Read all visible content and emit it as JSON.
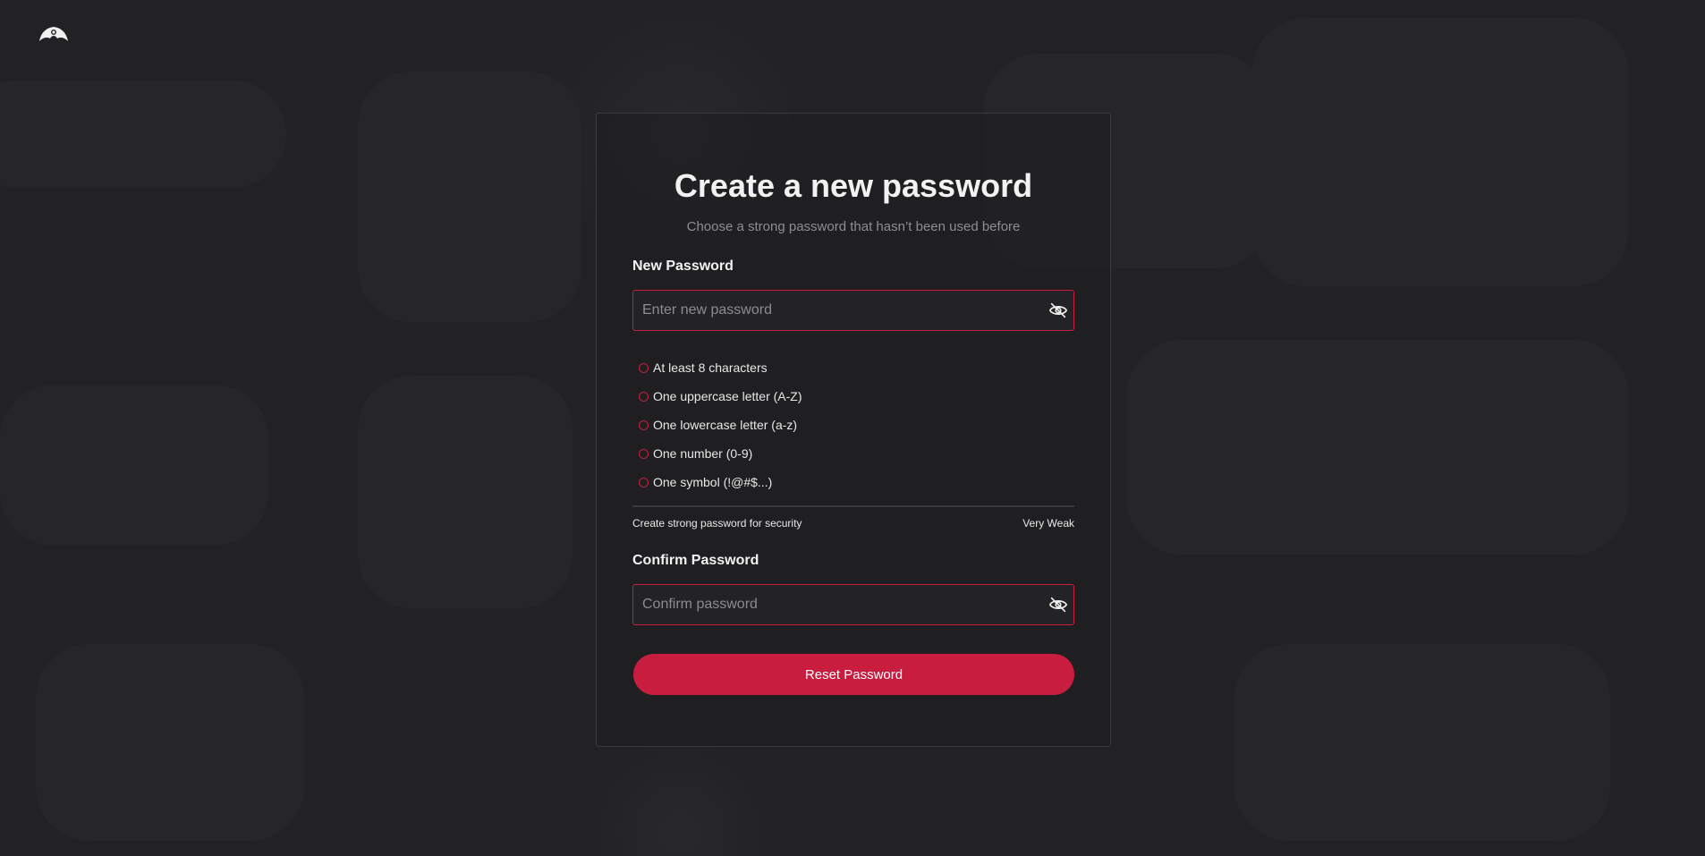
{
  "logo": {
    "icon": "bat-logo-icon"
  },
  "card": {
    "title": "Create a new password",
    "subtitle": "Choose a strong password that hasn’t been used before"
  },
  "new_password": {
    "label": "New Password",
    "placeholder": "Enter new password",
    "value": "",
    "toggle_icon": "eye-slash-icon"
  },
  "requirements": [
    {
      "label": "At least 8 characters",
      "met": false
    },
    {
      "label": "One uppercase letter (A-Z)",
      "met": false
    },
    {
      "label": "One lowercase letter (a-z)",
      "met": false
    },
    {
      "label": "One number (0-9)",
      "met": false
    },
    {
      "label": "One symbol (!@#$...)",
      "met": false
    }
  ],
  "strength": {
    "hint": "Create strong password for security",
    "level": "Very Weak",
    "fraction": 0
  },
  "confirm_password": {
    "label": "Confirm Password",
    "placeholder": "Confirm password",
    "value": "",
    "toggle_icon": "eye-slash-icon"
  },
  "submit": {
    "label": "Reset Password"
  },
  "colors": {
    "background": "#222224",
    "accent": "#c81d3f",
    "text": "#ffffff",
    "muted_text": "#8e8e92",
    "border": "#3a3a3d"
  }
}
